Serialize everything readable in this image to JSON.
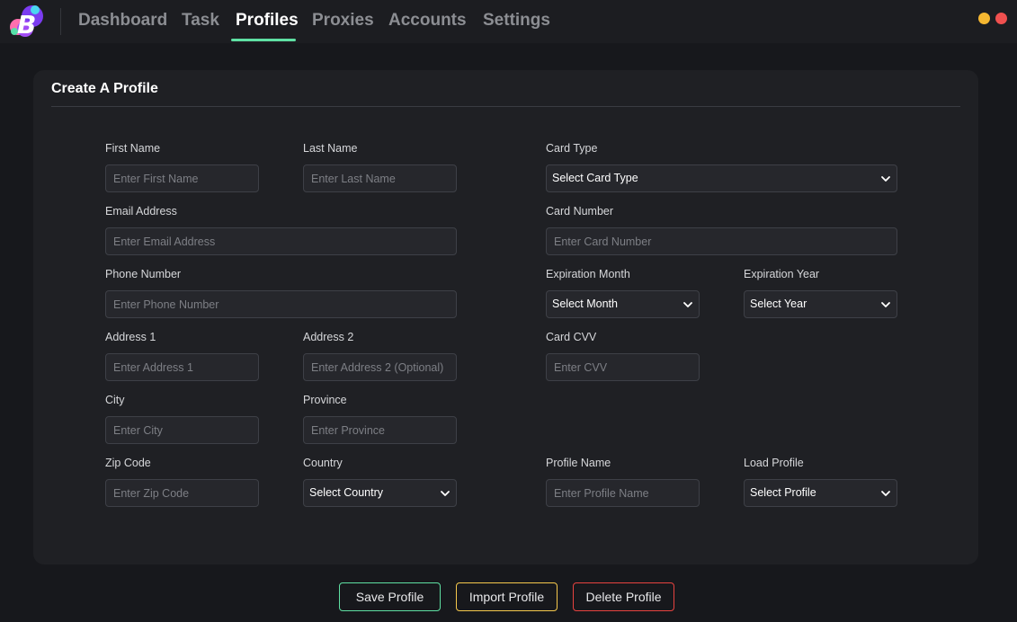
{
  "nav": {
    "items": [
      {
        "label": "Dashboard"
      },
      {
        "label": "Task"
      },
      {
        "label": "Profiles"
      },
      {
        "label": "Proxies"
      },
      {
        "label": "Accounts"
      },
      {
        "label": "Settings"
      }
    ],
    "active": "Profiles",
    "logo_letter": "B"
  },
  "window_controls": {
    "minimize_color": "#f5b731",
    "close_color": "#f0504f"
  },
  "card": {
    "title": "Create A Profile"
  },
  "form": {
    "first_name": {
      "label": "First Name",
      "placeholder": "Enter First Name"
    },
    "last_name": {
      "label": "Last Name",
      "placeholder": "Enter Last Name"
    },
    "email": {
      "label": "Email Address",
      "placeholder": "Enter Email Address"
    },
    "phone": {
      "label": "Phone Number",
      "placeholder": "Enter Phone Number"
    },
    "address1": {
      "label": "Address 1",
      "placeholder": "Enter Address 1"
    },
    "address2": {
      "label": "Address 2",
      "placeholder": "Enter Address 2 (Optional)"
    },
    "city": {
      "label": "City",
      "placeholder": "Enter City"
    },
    "province": {
      "label": "Province",
      "placeholder": "Enter Province"
    },
    "zip": {
      "label": "Zip Code",
      "placeholder": "Enter Zip Code"
    },
    "country": {
      "label": "Country",
      "value": "Select Country"
    },
    "card_type": {
      "label": "Card Type",
      "value": "Select Card Type"
    },
    "card_number": {
      "label": "Card Number",
      "placeholder": "Enter Card Number"
    },
    "exp_month": {
      "label": "Expiration Month",
      "value": "Select Month"
    },
    "exp_year": {
      "label": "Expiration Year",
      "value": "Select Year"
    },
    "cvv": {
      "label": "Card CVV",
      "placeholder": "Enter CVV"
    },
    "profile_name": {
      "label": "Profile Name",
      "placeholder": "Enter Profile Name"
    },
    "load_profile": {
      "label": "Load Profile",
      "value": "Select Profile"
    }
  },
  "buttons": {
    "save": {
      "label": "Save Profile",
      "color": "#5fe0a3"
    },
    "import": {
      "label": "Import Profile",
      "color": "#f5c84c"
    },
    "delete": {
      "label": "Delete Profile",
      "color": "#e8433f"
    }
  }
}
